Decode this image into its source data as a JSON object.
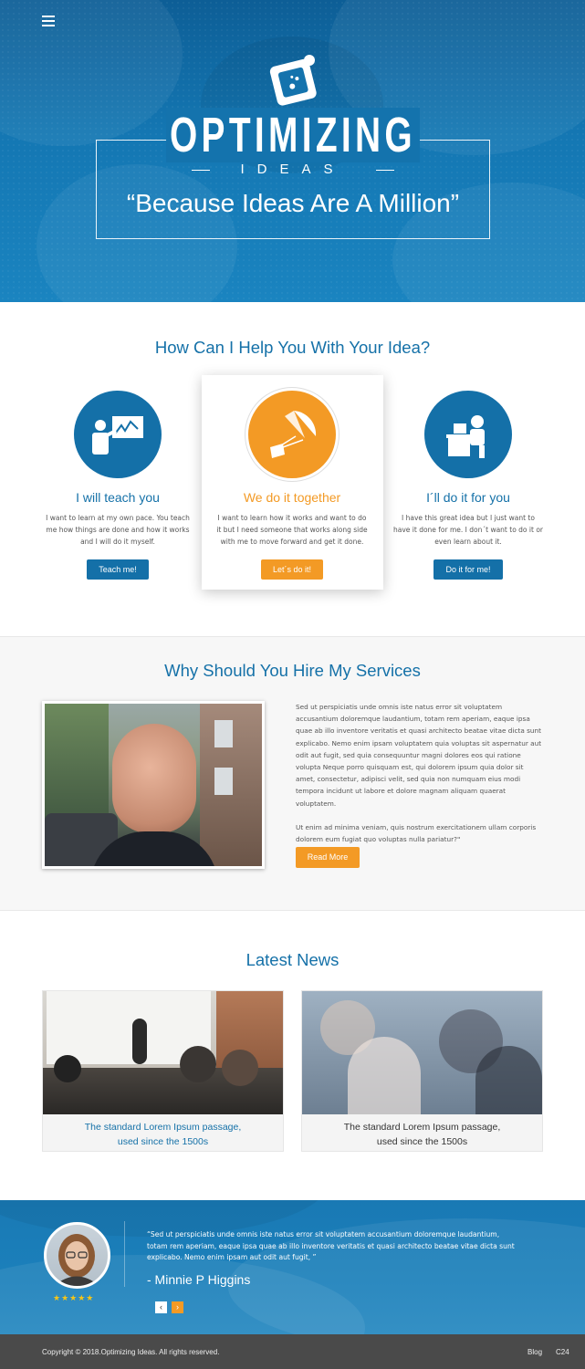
{
  "hero": {
    "brand_word": "OPTIMIZING",
    "brand_sub": "IDEAS",
    "tagline": "“Because Ideas Are A Million”"
  },
  "help": {
    "title": "How Can I Help You With Your Idea?",
    "services": [
      {
        "title": "I will teach you",
        "desc": "I want to learn at my own pace. You teach me how things are done and how it works and I will do it myself.",
        "button": "Teach me!",
        "color": "#1470a8"
      },
      {
        "title": "We do it together",
        "desc": "I want to learn how it works and want to do it but I need someone that works along side with me to move forward and get it done.",
        "button": "Let´s do it!",
        "color": "#f39a25"
      },
      {
        "title": "I´ll do it for you",
        "desc": "I have this great idea but I just want to have it done for me. I don´t want to do it or even learn about it.",
        "button": "Do it for me!",
        "color": "#1470a8"
      }
    ]
  },
  "why": {
    "title": "Why Should You Hire My Services",
    "para1": "Sed ut perspiciatis unde omnis iste natus error sit voluptatem accusantium doloremque laudantium, totam rem aperiam, eaque ipsa quae ab illo inventore veritatis et quasi architecto beatae vitae dicta sunt explicabo. Nemo enim ipsam voluptatem quia voluptas sit aspernatur aut odit aut fugit, sed quia consequuntur magni dolores eos qui ratione volupta Neque porro quisquam est, qui dolorem ipsum quia dolor sit amet, consectetur, adipisci velit, sed quia non numquam eius modi tempora incidunt ut labore et dolore magnam aliquam quaerat voluptatem.",
    "para2": "Ut enim ad minima veniam, quis nostrum exercitationem ullam corporis dolorem eum fugiat quo voluptas nulla pariatur?\"",
    "button": "Read More"
  },
  "news": {
    "title": "Latest News",
    "items": [
      {
        "caption_line1": "The standard Lorem Ipsum passage,",
        "caption_line2": "used since the 1500s",
        "color": "#1571a8"
      },
      {
        "caption_line1": "The standard Lorem Ipsum passage,",
        "caption_line2": "used since the 1500s",
        "color": "#333333"
      }
    ]
  },
  "testimonial": {
    "quote": "“Sed ut perspiciatis unde omnis iste natus error sit voluptatem accusantium doloremque laudantium, totam rem aperiam, eaque ipsa quae ab illo inventore veritatis et quasi architecto beatae vitae dicta sunt explicabo. Nemo enim ipsam  aut odit aut fugit, ”",
    "author": "- Minnie P Higgins",
    "stars": "★★★★★",
    "prev": "‹",
    "next": "›"
  },
  "footer": {
    "copyright": "Copyright © 2018.Optimizing Ideas. All rights reserved.",
    "links": [
      "Blog",
      "C24"
    ]
  },
  "colors": {
    "brand_blue": "#1571a8",
    "accent_orange": "#f39a25",
    "footer": "#4a4a4a"
  },
  "icons": [
    "menu-icon",
    "logo-icon",
    "teacher-icon",
    "parachute-icon",
    "desk-worker-icon"
  ]
}
